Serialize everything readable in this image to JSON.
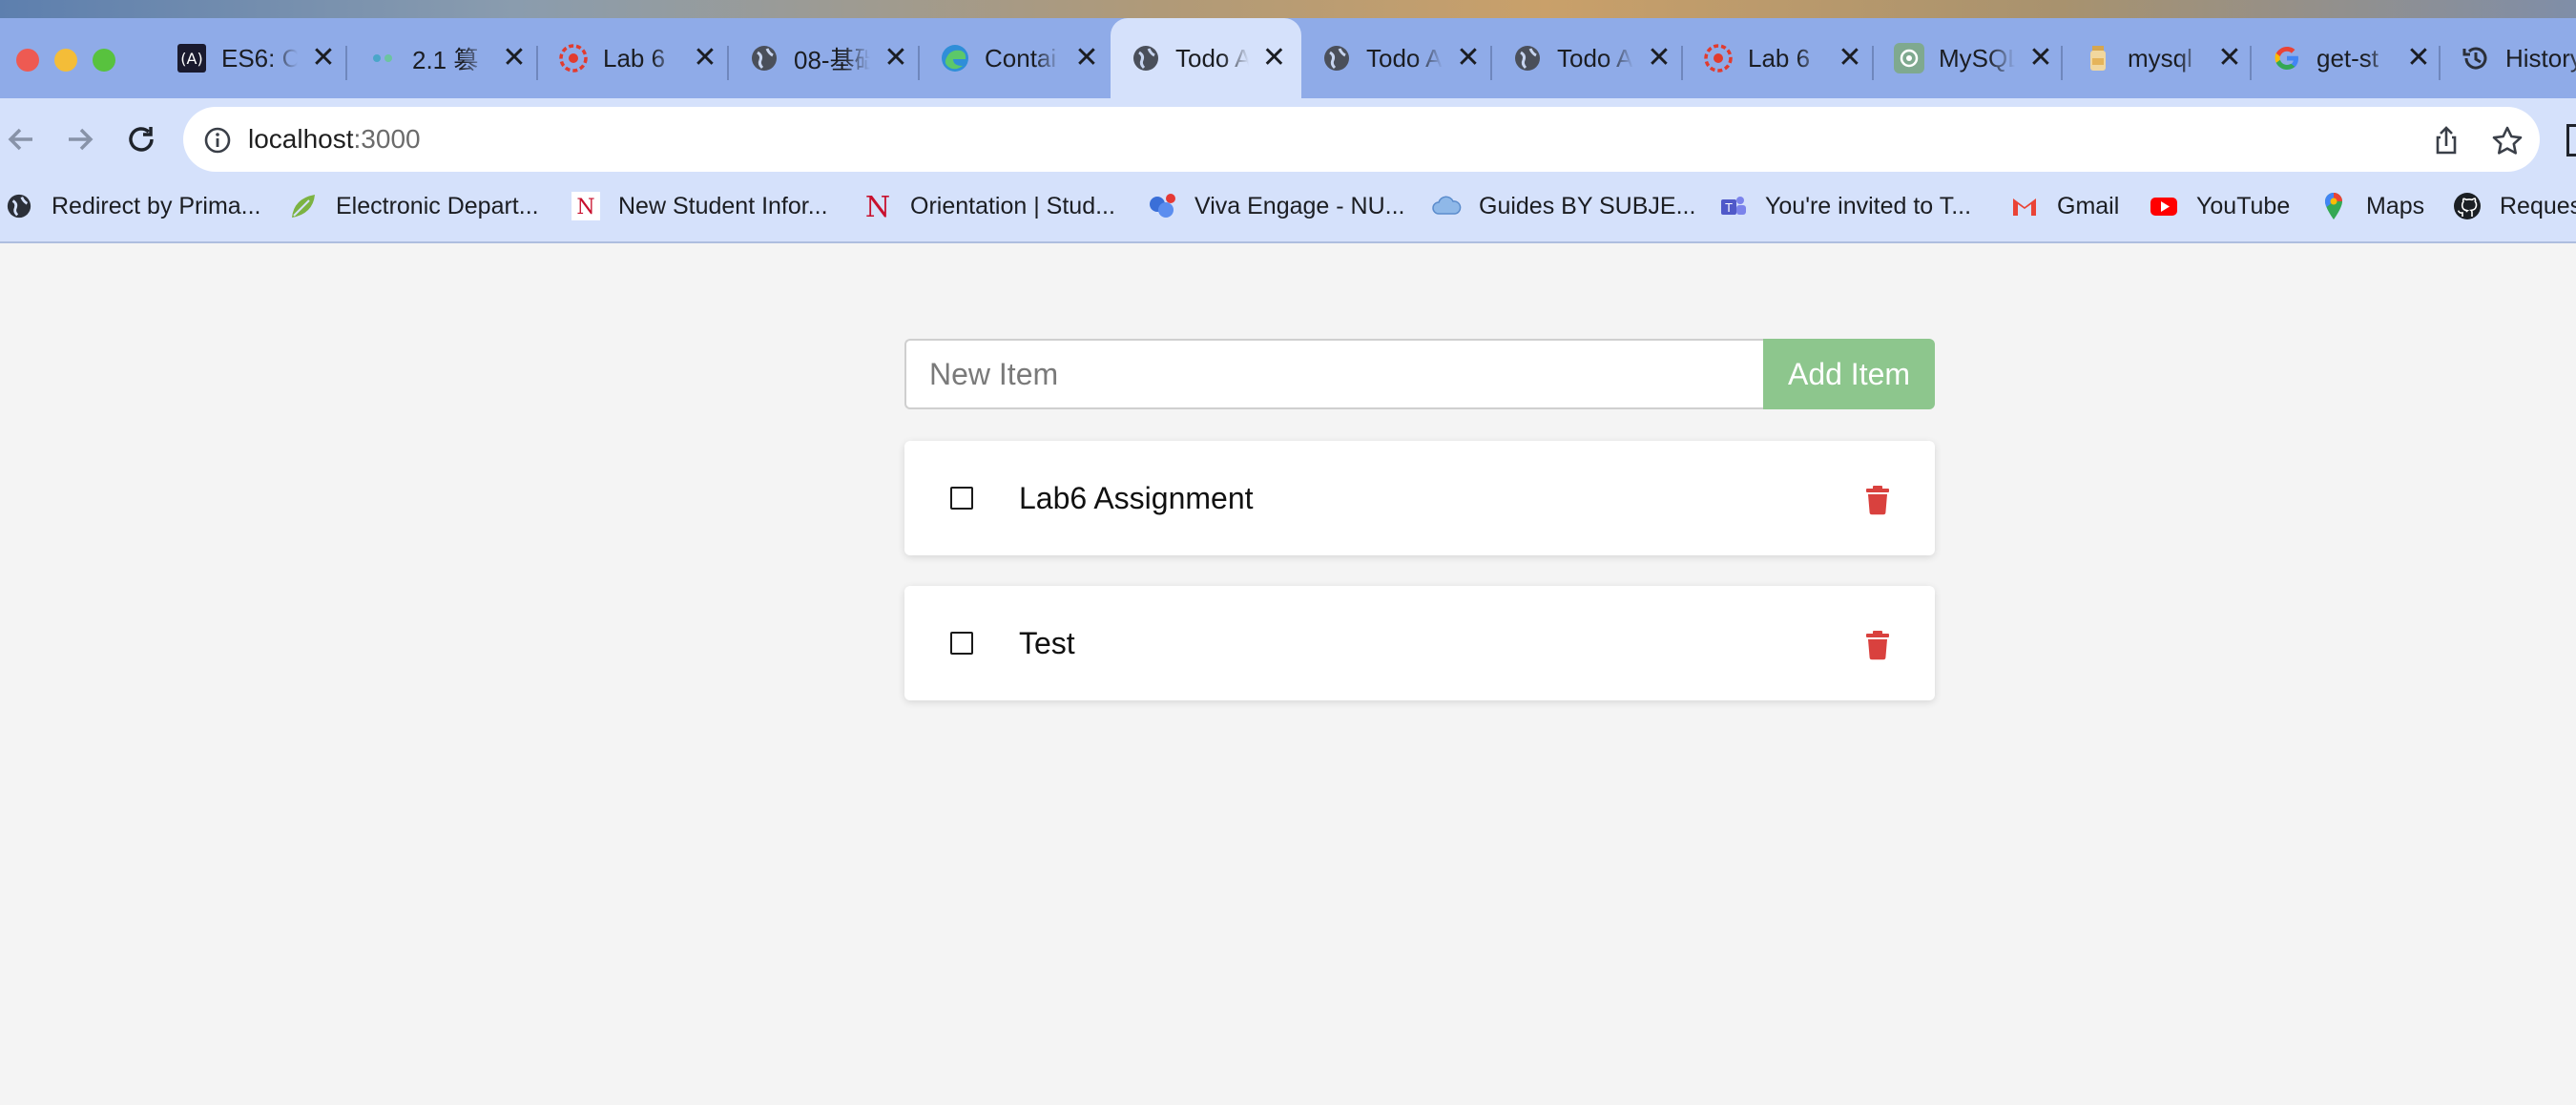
{
  "browser": {
    "tabs": [
      {
        "title": "ES6: C",
        "icon": "es6-site-icon",
        "active": false
      },
      {
        "title": "2.1 篡",
        "icon": "site-icon",
        "active": false
      },
      {
        "title": "Lab 6",
        "icon": "canvas-icon",
        "active": false
      },
      {
        "title": "08-基础",
        "icon": "globe-icon",
        "active": false
      },
      {
        "title": "Contai",
        "icon": "edge-icon",
        "active": false
      },
      {
        "title": "Todo A",
        "icon": "globe-icon",
        "active": true
      },
      {
        "title": "Todo A",
        "icon": "globe-icon",
        "active": false
      },
      {
        "title": "Todo A",
        "icon": "globe-icon",
        "active": false
      },
      {
        "title": "Lab 6",
        "icon": "canvas-icon",
        "active": false
      },
      {
        "title": "MySQL",
        "icon": "chatgpt-icon",
        "active": false
      },
      {
        "title": "mysql",
        "icon": "jar-icon",
        "active": false
      },
      {
        "title": "get-st",
        "icon": "google-icon",
        "active": false
      },
      {
        "title": "History",
        "icon": "history-icon",
        "active": false
      }
    ],
    "address": {
      "host": "localhost",
      "port": ":3000"
    },
    "bookmarks": [
      {
        "label": "Redirect by Prima...",
        "icon": "globe-icon"
      },
      {
        "label": "Electronic Depart...",
        "icon": "leaf-icon"
      },
      {
        "label": "New Student Infor...",
        "icon": "northeastern-icon"
      },
      {
        "label": "Orientation | Stud...",
        "icon": "northeastern-icon"
      },
      {
        "label": "Viva Engage - NU...",
        "icon": "viva-engage-icon"
      },
      {
        "label": "Guides BY SUBJE...",
        "icon": "cloud-icon"
      },
      {
        "label": "You're invited to T...",
        "icon": "teams-icon"
      },
      {
        "label": "Gmail",
        "icon": "gmail-icon"
      },
      {
        "label": "YouTube",
        "icon": "youtube-icon"
      },
      {
        "label": "Maps",
        "icon": "maps-icon"
      },
      {
        "label": "Reques",
        "icon": "github-icon"
      }
    ]
  },
  "app": {
    "input_placeholder": "New Item",
    "add_button_label": "Add Item",
    "items": [
      {
        "text": "Lab6 Assignment",
        "completed": false
      },
      {
        "text": "Test",
        "completed": false
      }
    ],
    "colors": {
      "add_button": "#8dc68d",
      "delete_icon": "#d9413e",
      "background": "#f4f4f4"
    }
  }
}
